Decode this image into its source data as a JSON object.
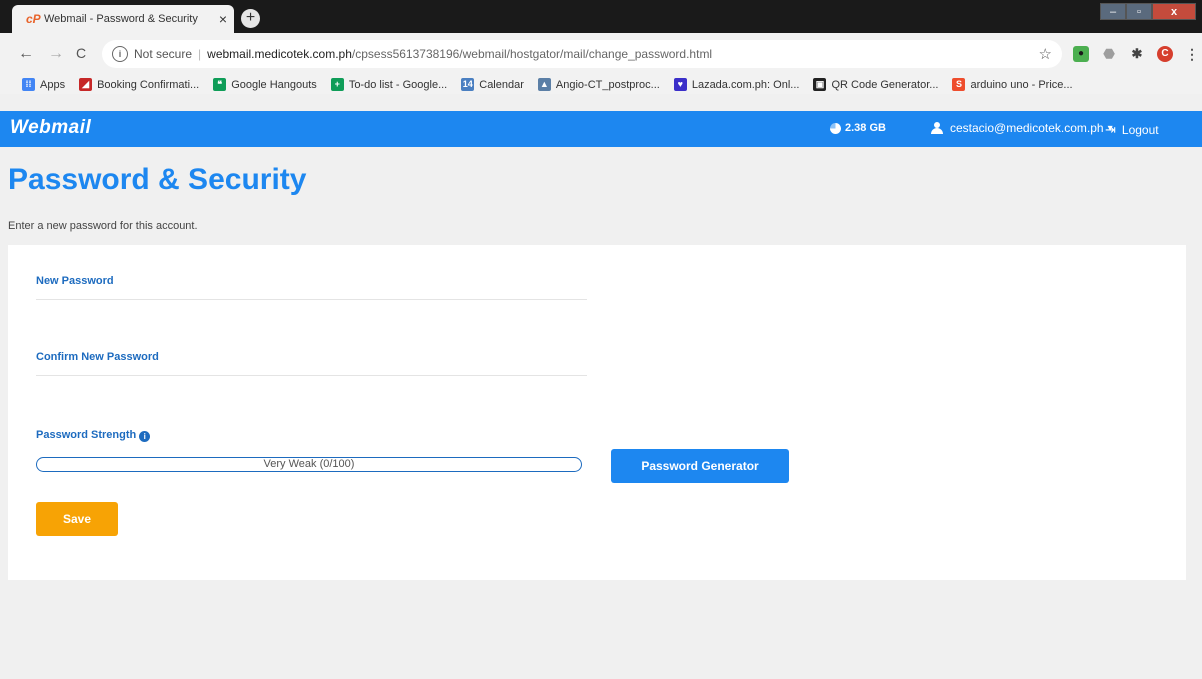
{
  "browser": {
    "tab": {
      "favicon": "cP",
      "title": "Webmail - Password & Security",
      "close": "×"
    },
    "new_tab": "+",
    "window_controls": {
      "min": "–",
      "max": "▫",
      "close": "x"
    },
    "nav": {
      "back": "←",
      "forward": "→",
      "reload": "C"
    },
    "address": {
      "info": "i",
      "not_secure": "Not secure",
      "separator": "|",
      "host": "webmail.medicotek.com.ph",
      "path": "/cpsess5613738196/webmail/hostgator/mail/change_password.html",
      "star": "☆"
    },
    "extensions": {
      "e1": "●",
      "e2": "⬣",
      "e3": "✱",
      "profile": "C",
      "menu": "⋮"
    },
    "bookmarks": [
      {
        "label": "Apps",
        "icon": "apps-icon",
        "glyph": "⁞⁞",
        "color": "#4285f4"
      },
      {
        "label": "Booking Confirmati...",
        "icon": "airline-icon",
        "glyph": "◢",
        "color": "#c62828"
      },
      {
        "label": "Google Hangouts",
        "icon": "hangouts-icon",
        "glyph": "❝",
        "color": "#0f9d58"
      },
      {
        "label": "To-do list - Google...",
        "icon": "sheets-icon",
        "glyph": "+",
        "color": "#0f9d58"
      },
      {
        "label": "Calendar",
        "icon": "calendar-icon",
        "glyph": "14",
        "color": "#4a7fc1"
      },
      {
        "label": "Angio-CT_postproc...",
        "icon": "image-icon",
        "glyph": "▲",
        "color": "#5b7fa6"
      },
      {
        "label": "Lazada.com.ph: Onl...",
        "icon": "lazada-icon",
        "glyph": "♥",
        "color": "#3b2fc9"
      },
      {
        "label": "QR Code Generator...",
        "icon": "qr-icon",
        "glyph": "▣",
        "color": "#222222"
      },
      {
        "label": "arduino uno - Price...",
        "icon": "shopee-icon",
        "glyph": "S",
        "color": "#ee4d2d"
      }
    ]
  },
  "app": {
    "brand": "Webmail",
    "quota": "2.38 GB",
    "user": "cestacio@medicotek.com.ph",
    "user_caret": "▾",
    "logout_glyph": "⇥",
    "logout": "Logout",
    "accent": "#1d87f0"
  },
  "page": {
    "title": "Password & Security",
    "description": "Enter a new password for this account.",
    "new_password_label": "New Password",
    "new_password_value": "",
    "confirm_label": "Confirm New Password",
    "confirm_value": "",
    "strength_label": "Password Strength",
    "strength_info": "i",
    "strength_text": "Very Weak (0/100)",
    "strength_score": 0,
    "generator_button": "Password Generator",
    "save_button": "Save"
  }
}
